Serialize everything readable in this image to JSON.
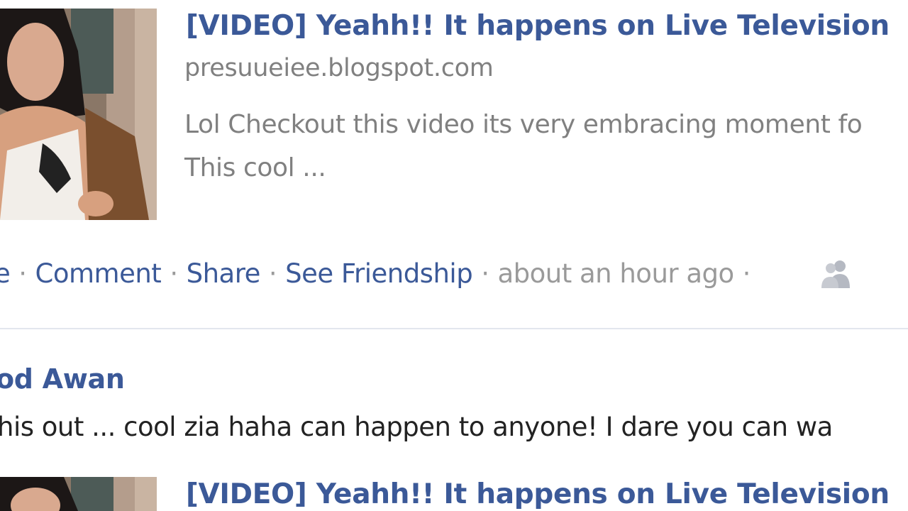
{
  "post1": {
    "link_title": "[VIDEO] Yeahh!! It happens on Live Television",
    "link_domain": "presuueiee.blogspot.com",
    "desc_line1": "Lol Checkout this video its very embracing moment fo",
    "desc_line2": "This cool ...",
    "actions": {
      "like_partial": "e",
      "comment": "Comment",
      "share": "Share",
      "see_friendship": "See Friendship",
      "timestamp": "about an hour ago",
      "separator": "·",
      "audience_icon": "friends-icon"
    }
  },
  "post2": {
    "author_partial": "od Awan",
    "message_partial": "his out ... cool zia haha can happen to anyone! I dare you can wa",
    "link_title": "[VIDEO] Yeahh!! It happens on Live Television"
  },
  "colors": {
    "link_blue": "#3b5998",
    "meta_gray": "#808080",
    "divider": "#e3e6ee"
  }
}
